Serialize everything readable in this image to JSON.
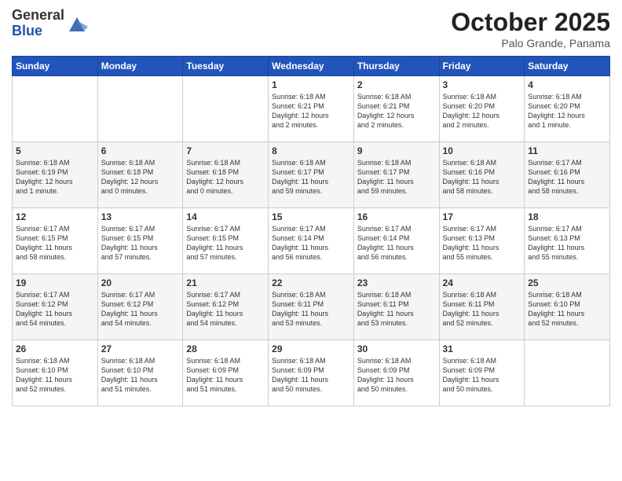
{
  "header": {
    "logo_general": "General",
    "logo_blue": "Blue",
    "title": "October 2025",
    "location": "Palo Grande, Panama"
  },
  "days_of_week": [
    "Sunday",
    "Monday",
    "Tuesday",
    "Wednesday",
    "Thursday",
    "Friday",
    "Saturday"
  ],
  "weeks": [
    [
      {
        "day": "",
        "info": ""
      },
      {
        "day": "",
        "info": ""
      },
      {
        "day": "",
        "info": ""
      },
      {
        "day": "1",
        "info": "Sunrise: 6:18 AM\nSunset: 6:21 PM\nDaylight: 12 hours\nand 2 minutes."
      },
      {
        "day": "2",
        "info": "Sunrise: 6:18 AM\nSunset: 6:21 PM\nDaylight: 12 hours\nand 2 minutes."
      },
      {
        "day": "3",
        "info": "Sunrise: 6:18 AM\nSunset: 6:20 PM\nDaylight: 12 hours\nand 2 minutes."
      },
      {
        "day": "4",
        "info": "Sunrise: 6:18 AM\nSunset: 6:20 PM\nDaylight: 12 hours\nand 1 minute."
      }
    ],
    [
      {
        "day": "5",
        "info": "Sunrise: 6:18 AM\nSunset: 6:19 PM\nDaylight: 12 hours\nand 1 minute."
      },
      {
        "day": "6",
        "info": "Sunrise: 6:18 AM\nSunset: 6:18 PM\nDaylight: 12 hours\nand 0 minutes."
      },
      {
        "day": "7",
        "info": "Sunrise: 6:18 AM\nSunset: 6:18 PM\nDaylight: 12 hours\nand 0 minutes."
      },
      {
        "day": "8",
        "info": "Sunrise: 6:18 AM\nSunset: 6:17 PM\nDaylight: 11 hours\nand 59 minutes."
      },
      {
        "day": "9",
        "info": "Sunrise: 6:18 AM\nSunset: 6:17 PM\nDaylight: 11 hours\nand 59 minutes."
      },
      {
        "day": "10",
        "info": "Sunrise: 6:18 AM\nSunset: 6:16 PM\nDaylight: 11 hours\nand 58 minutes."
      },
      {
        "day": "11",
        "info": "Sunrise: 6:17 AM\nSunset: 6:16 PM\nDaylight: 11 hours\nand 58 minutes."
      }
    ],
    [
      {
        "day": "12",
        "info": "Sunrise: 6:17 AM\nSunset: 6:15 PM\nDaylight: 11 hours\nand 58 minutes."
      },
      {
        "day": "13",
        "info": "Sunrise: 6:17 AM\nSunset: 6:15 PM\nDaylight: 11 hours\nand 57 minutes."
      },
      {
        "day": "14",
        "info": "Sunrise: 6:17 AM\nSunset: 6:15 PM\nDaylight: 11 hours\nand 57 minutes."
      },
      {
        "day": "15",
        "info": "Sunrise: 6:17 AM\nSunset: 6:14 PM\nDaylight: 11 hours\nand 56 minutes."
      },
      {
        "day": "16",
        "info": "Sunrise: 6:17 AM\nSunset: 6:14 PM\nDaylight: 11 hours\nand 56 minutes."
      },
      {
        "day": "17",
        "info": "Sunrise: 6:17 AM\nSunset: 6:13 PM\nDaylight: 11 hours\nand 55 minutes."
      },
      {
        "day": "18",
        "info": "Sunrise: 6:17 AM\nSunset: 6:13 PM\nDaylight: 11 hours\nand 55 minutes."
      }
    ],
    [
      {
        "day": "19",
        "info": "Sunrise: 6:17 AM\nSunset: 6:12 PM\nDaylight: 11 hours\nand 54 minutes."
      },
      {
        "day": "20",
        "info": "Sunrise: 6:17 AM\nSunset: 6:12 PM\nDaylight: 11 hours\nand 54 minutes."
      },
      {
        "day": "21",
        "info": "Sunrise: 6:17 AM\nSunset: 6:12 PM\nDaylight: 11 hours\nand 54 minutes."
      },
      {
        "day": "22",
        "info": "Sunrise: 6:18 AM\nSunset: 6:11 PM\nDaylight: 11 hours\nand 53 minutes."
      },
      {
        "day": "23",
        "info": "Sunrise: 6:18 AM\nSunset: 6:11 PM\nDaylight: 11 hours\nand 53 minutes."
      },
      {
        "day": "24",
        "info": "Sunrise: 6:18 AM\nSunset: 6:11 PM\nDaylight: 11 hours\nand 52 minutes."
      },
      {
        "day": "25",
        "info": "Sunrise: 6:18 AM\nSunset: 6:10 PM\nDaylight: 11 hours\nand 52 minutes."
      }
    ],
    [
      {
        "day": "26",
        "info": "Sunrise: 6:18 AM\nSunset: 6:10 PM\nDaylight: 11 hours\nand 52 minutes."
      },
      {
        "day": "27",
        "info": "Sunrise: 6:18 AM\nSunset: 6:10 PM\nDaylight: 11 hours\nand 51 minutes."
      },
      {
        "day": "28",
        "info": "Sunrise: 6:18 AM\nSunset: 6:09 PM\nDaylight: 11 hours\nand 51 minutes."
      },
      {
        "day": "29",
        "info": "Sunrise: 6:18 AM\nSunset: 6:09 PM\nDaylight: 11 hours\nand 50 minutes."
      },
      {
        "day": "30",
        "info": "Sunrise: 6:18 AM\nSunset: 6:09 PM\nDaylight: 11 hours\nand 50 minutes."
      },
      {
        "day": "31",
        "info": "Sunrise: 6:18 AM\nSunset: 6:09 PM\nDaylight: 11 hours\nand 50 minutes."
      },
      {
        "day": "",
        "info": ""
      }
    ]
  ]
}
